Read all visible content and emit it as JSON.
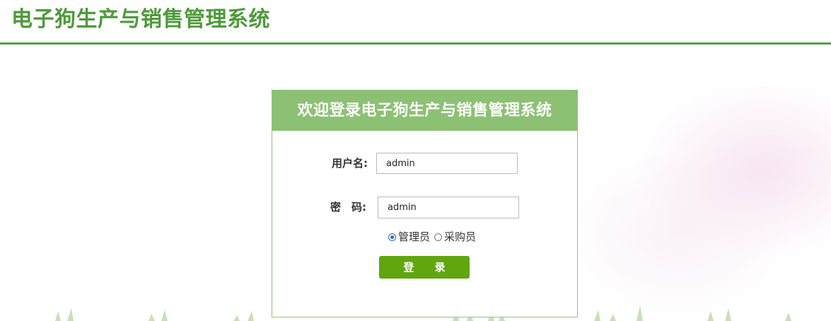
{
  "header": {
    "title": "电子狗生产与销售管理系统"
  },
  "login": {
    "heading": "欢迎登录电子狗生产与销售管理系统",
    "username_label": "用户名:",
    "username_value": "admin",
    "password_label": "密　码:",
    "password_value": "admin",
    "roles": [
      {
        "label": "管理员",
        "checked": true
      },
      {
        "label": "采购员",
        "checked": false
      }
    ],
    "submit_label": "登 录"
  },
  "colors": {
    "brand_green": "#4e9a3a",
    "header_panel": "#8cc174",
    "button": "#5fa60f"
  }
}
